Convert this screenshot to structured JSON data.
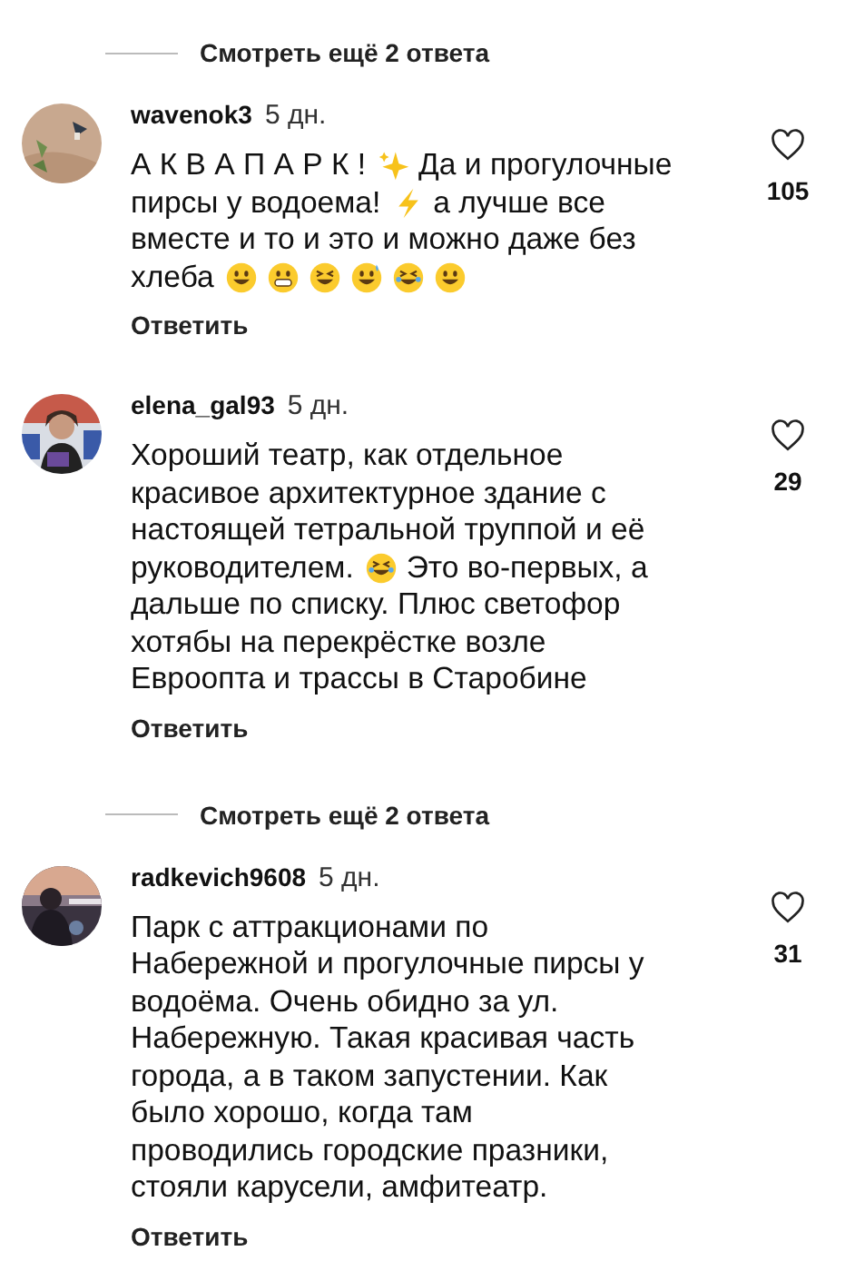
{
  "replies_link_top": {
    "label": "Смотреть ещё 2 ответа"
  },
  "comments": [
    {
      "avatar": {
        "kind": "picture"
      },
      "username": "wavenok3",
      "time": "5 дн.",
      "likes": "105",
      "liked": false,
      "reply": "Ответить",
      "body": [
        [
          {
            "kind": "text",
            "text": "А К В А П А Р К !"
          },
          {
            "kind": "sparkles"
          },
          {
            "kind": "text",
            "text": "Да и прогулочные"
          }
        ],
        [
          {
            "kind": "text",
            "text": "пирсы у водоема!"
          },
          {
            "kind": "bolt"
          },
          {
            "kind": "text",
            "text": "а лучше все"
          }
        ],
        [
          {
            "kind": "text",
            "text": "вместе и то и это и можно даже без"
          }
        ],
        [
          {
            "kind": "text",
            "text": "хлеба"
          },
          {
            "kind": "smile"
          },
          {
            "kind": "grin"
          },
          {
            "kind": "squint"
          },
          {
            "kind": "sweat"
          },
          {
            "kind": "rofl"
          },
          {
            "kind": "smile"
          }
        ]
      ]
    },
    {
      "avatar": {
        "kind": "picture"
      },
      "username": "elena_gal93",
      "time": "5 дн.",
      "likes": "29",
      "liked": false,
      "reply": "Ответить",
      "body": [
        [
          {
            "kind": "text",
            "text": "Хороший театр, как отдельное"
          }
        ],
        [
          {
            "kind": "text",
            "text": "красивое архитектурное здание с"
          }
        ],
        [
          {
            "kind": "text",
            "text": "настоящей тетральной труппой и её"
          }
        ],
        [
          {
            "kind": "text",
            "text": "руководителем."
          },
          {
            "kind": "joy"
          },
          {
            "kind": "text",
            "text": "Это во-первых, а"
          }
        ],
        [
          {
            "kind": "text",
            "text": "дальше по списку. Плюс светофор"
          }
        ],
        [
          {
            "kind": "text",
            "text": "хотябы на перекрёстке возле"
          }
        ],
        [
          {
            "kind": "text",
            "text": "Евроопта и трассы в Старобине"
          }
        ]
      ],
      "more_replies": "Смотреть ещё 2 ответа"
    },
    {
      "avatar": {
        "kind": "picture"
      },
      "username": "radkevich9608",
      "time": "5 дн.",
      "likes": "31",
      "liked": false,
      "reply": "Ответить",
      "body": [
        [
          {
            "kind": "text",
            "text": "Парк с аттракционами по"
          }
        ],
        [
          {
            "kind": "text",
            "text": "Набережной и прогулочные пирсы у"
          }
        ],
        [
          {
            "kind": "text",
            "text": "водоёма. Очень обидно за ул."
          }
        ],
        [
          {
            "kind": "text",
            "text": "Набережную. Такая красивая часть"
          }
        ],
        [
          {
            "kind": "text",
            "text": "города, а в таком запустении. Как"
          }
        ],
        [
          {
            "kind": "text",
            "text": "было хорошо, когда там"
          }
        ],
        [
          {
            "kind": "text",
            "text": "проводились городские празники,"
          }
        ],
        [
          {
            "kind": "text",
            "text": "стояли карусели, амфитеатр."
          }
        ]
      ]
    }
  ]
}
